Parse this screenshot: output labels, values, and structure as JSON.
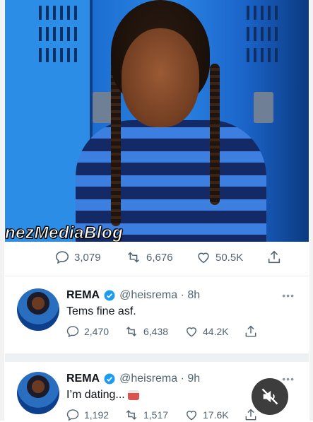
{
  "photo": {
    "watermark": "nezMediaBlog"
  },
  "main_tweet": {
    "reply_count": "3,079",
    "retweet_count": "6,676",
    "like_count": "50.5K"
  },
  "tweets": [
    {
      "name": "REMA",
      "handle_time": "@heisrema · 8h",
      "text": "Tems fine asf.",
      "reply_count": "2,470",
      "retweet_count": "6,438",
      "like_count": "44.2K",
      "more": "•••"
    },
    {
      "name": "REMA",
      "handle_time": "@heisrema · 9h",
      "text": "I’m dating...",
      "reply_count": "1,192",
      "retweet_count": "1,517",
      "like_count": "17.6K",
      "more": "•••"
    }
  ],
  "colors": {
    "verified": "#1d9bf0",
    "muted_text": "#536471"
  }
}
